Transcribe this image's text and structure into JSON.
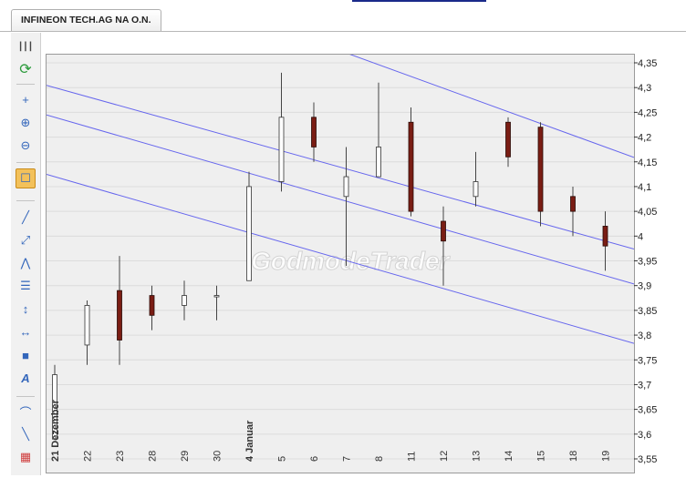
{
  "tab": {
    "title": "INFINEON TECH.AG NA O.N."
  },
  "watermark": "GodmodeTrader",
  "toolbar": {
    "tools": [
      {
        "name": "columns-icon",
        "glyph": "┃┃┃"
      },
      {
        "name": "refresh-icon",
        "glyph": "⟳"
      },
      {
        "name": "crosshair-icon",
        "glyph": "+"
      },
      {
        "name": "zoom-in-icon",
        "glyph": "⊕"
      },
      {
        "name": "zoom-out-icon",
        "glyph": "⊖"
      },
      {
        "name": "cursor-select-icon",
        "glyph": "☐"
      },
      {
        "name": "line-tool-icon",
        "glyph": "╱"
      },
      {
        "name": "ray-tool-icon",
        "glyph": "⤢"
      },
      {
        "name": "angle-tool-icon",
        "glyph": "⋀"
      },
      {
        "name": "fibonacci-icon",
        "glyph": "☰"
      },
      {
        "name": "vertical-measure-icon",
        "glyph": "↕"
      },
      {
        "name": "horizontal-measure-icon",
        "glyph": "↔"
      },
      {
        "name": "rectangle-icon",
        "glyph": "■"
      },
      {
        "name": "text-tool-icon",
        "glyph": "A"
      },
      {
        "name": "arc-tool-icon",
        "glyph": "⌒"
      },
      {
        "name": "pen-tool-icon",
        "glyph": "╲"
      },
      {
        "name": "palette-icon",
        "glyph": "▦"
      }
    ]
  },
  "chart_data": {
    "type": "candlestick",
    "title": "INFINEON TECH.AG NA O.N.",
    "y_axis": {
      "min": 3.55,
      "max": 4.35,
      "step": 0.05,
      "side": "right",
      "decimal_separator": ","
    },
    "grid": true,
    "x_labels": [
      "21 Dezember",
      "22",
      "23",
      "28",
      "29",
      "30",
      "4 Januar",
      "5",
      "6",
      "7",
      "8",
      "11",
      "12",
      "13",
      "14",
      "15",
      "18",
      "19"
    ],
    "bold_labels": [
      "21 Dezember",
      "4 Januar"
    ],
    "candles": [
      {
        "date": "21 Dezember",
        "open": 3.59,
        "high": 3.74,
        "low": 3.59,
        "close": 3.72
      },
      {
        "date": "22",
        "open": 3.78,
        "high": 3.87,
        "low": 3.74,
        "close": 3.86
      },
      {
        "date": "23",
        "open": 3.89,
        "high": 3.96,
        "low": 3.74,
        "close": 3.79
      },
      {
        "date": "28",
        "open": 3.88,
        "high": 3.9,
        "low": 3.81,
        "close": 3.84
      },
      {
        "date": "29",
        "open": 3.86,
        "high": 3.91,
        "low": 3.83,
        "close": 3.88
      },
      {
        "date": "30",
        "open": 3.88,
        "high": 3.9,
        "low": 3.83,
        "close": 3.88
      },
      {
        "date": "4 Januar",
        "open": 3.91,
        "high": 4.13,
        "low": 3.91,
        "close": 4.1
      },
      {
        "date": "5",
        "open": 4.11,
        "high": 4.33,
        "low": 4.09,
        "close": 4.24
      },
      {
        "date": "6",
        "open": 4.24,
        "high": 4.27,
        "low": 4.15,
        "close": 4.18
      },
      {
        "date": "7",
        "open": 4.08,
        "high": 4.18,
        "low": 3.94,
        "close": 4.12
      },
      {
        "date": "8",
        "open": 4.12,
        "high": 4.31,
        "low": 4.12,
        "close": 4.18
      },
      {
        "date": "11",
        "open": 4.23,
        "high": 4.26,
        "low": 4.04,
        "close": 4.05
      },
      {
        "date": "12",
        "open": 4.03,
        "high": 4.06,
        "low": 3.9,
        "close": 3.99
      },
      {
        "date": "13",
        "open": 4.08,
        "high": 4.17,
        "low": 4.06,
        "close": 4.11
      },
      {
        "date": "14",
        "open": 4.23,
        "high": 4.24,
        "low": 4.14,
        "close": 4.16
      },
      {
        "date": "15",
        "open": 4.22,
        "high": 4.23,
        "low": 4.02,
        "close": 4.05
      },
      {
        "date": "18",
        "open": 4.08,
        "high": 4.1,
        "low": 4.0,
        "close": 4.05
      },
      {
        "date": "19",
        "open": 4.02,
        "high": 4.05,
        "low": 3.93,
        "close": 3.98
      }
    ],
    "trend_lines": [
      {
        "start": {
          "date": "7",
          "value": 4.37
        },
        "end": {
          "date": "19",
          "value": 4.18
        }
      },
      {
        "start": {
          "date": "21 Dezember",
          "value": 4.3
        },
        "end": {
          "date": "19",
          "value": 3.99
        }
      },
      {
        "start": {
          "date": "21 Dezember",
          "value": 4.24
        },
        "end": {
          "date": "19",
          "value": 3.92
        }
      },
      {
        "start": {
          "date": "21 Dezember",
          "value": 4.12
        },
        "end": {
          "date": "19",
          "value": 3.8
        }
      }
    ],
    "colors": {
      "up_fill": "#ffffff",
      "down_fill": "#7a1d14",
      "wick": "#444444",
      "trend_line": "#6666ee",
      "grid": "#dcdcdc",
      "background": "#efefef"
    }
  }
}
